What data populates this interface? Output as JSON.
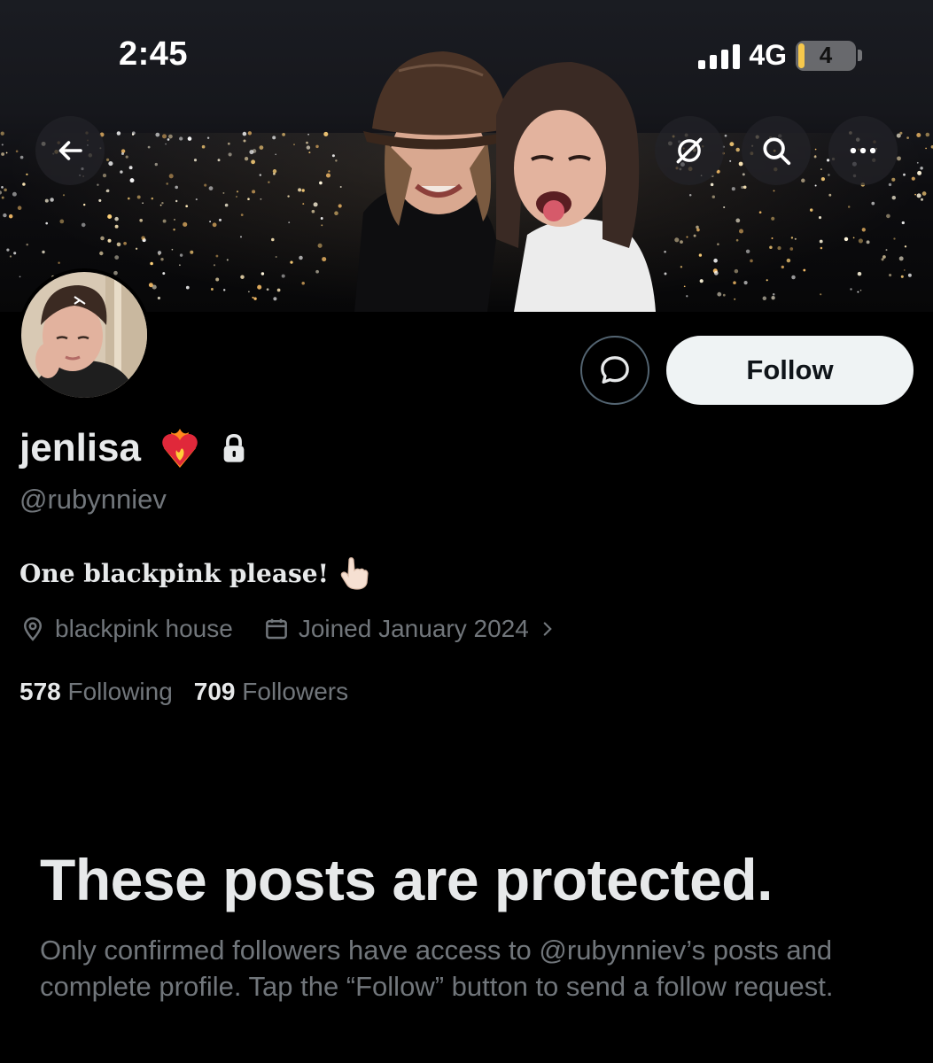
{
  "status_bar": {
    "time": "2:45",
    "network": "4G",
    "battery": "4"
  },
  "banner": {
    "description_icon": "city-night-photo"
  },
  "nav": {
    "back_icon": "arrow-left-icon",
    "grok_icon": "slashed-circle-icon",
    "search_icon": "search-icon",
    "more_icon": "more-dots-icon"
  },
  "profile": {
    "display_name": "jenlisa",
    "handle": "@rubynniev",
    "bio": "One blackpink please!",
    "location": "blackpink house",
    "joined": "Joined January 2024",
    "following_count": "578",
    "following_label": "Following",
    "followers_count": "709",
    "followers_label": "Followers",
    "follow_label": "Follow"
  },
  "protected": {
    "title": "These posts are protected.",
    "body": "Only confirmed followers have access to @rubynniev’s posts and complete profile. Tap the “Follow” button to send a follow request."
  },
  "colors": {
    "background": "#000000",
    "primary_text": "#e7e9ea",
    "secondary_text": "#71767b",
    "follow_button": "#eff3f4"
  }
}
